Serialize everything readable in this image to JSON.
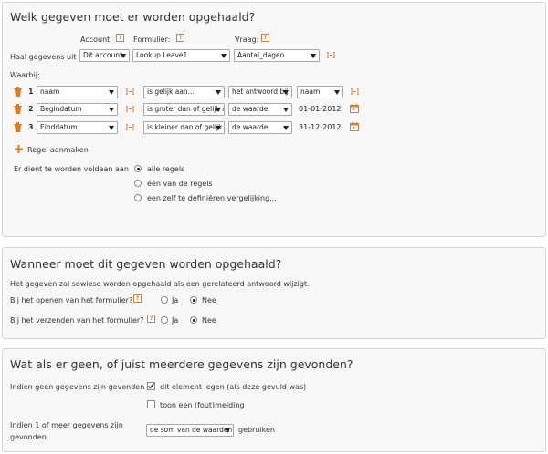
{
  "section1": {
    "title": "Welk gegeven moet er worden opgehaald?",
    "col_account": "Account:",
    "col_formulier": "Formulier:",
    "col_vraag": "Vraag:",
    "haal_label": "Haal gegevens uit",
    "account_value": "Dit account",
    "formulier_value": "Lookup.Leave1",
    "vraag_value": "Aantal_dagen",
    "waarbij": "Waarbij:",
    "rows": [
      {
        "n": "1",
        "field": "naam",
        "operator": "is gelijk aan...",
        "type": "het antwoord bij",
        "value": "naam"
      },
      {
        "n": "2",
        "field": "Begindatum",
        "operator": "is groter dan of gelijk a",
        "type": "de waarde",
        "value": "01-01-2012"
      },
      {
        "n": "3",
        "field": "Einddatum",
        "operator": "is kleiner dan of gelijk a",
        "type": "de waarde",
        "value": "31-12-2012"
      }
    ],
    "add_rule": "Regel aanmaken",
    "condition_label": "Er dient te worden voldaan aan",
    "options": [
      "alle regels",
      "één van de regels",
      "een zelf te definiëren vergelijking..."
    ]
  },
  "section2": {
    "title": "Wanneer moet dit gegeven worden opgehaald?",
    "info": "Het gegeven zal sowieso worden opgehaald als een gerelateerd antwoord wijzigt.",
    "open_label": "Bij het openen van het formulier?",
    "send_label": "Bij het verzenden van het formulier?",
    "ja": "Ja",
    "nee": "Nee"
  },
  "section3": {
    "title": "Wat als er geen, of juist meerdere gegevens zijn gevonden?",
    "none_label": "Indien geen gegevens zijn gevonden",
    "clear_option": "dit element legen (als deze gevuld was)",
    "error_option": "toon een (fout)melding",
    "multi_label_1": "Indien 1 of meer gegevens zijn",
    "multi_label_2": "gevonden",
    "aggregate_value": "de som van de waarden",
    "use_label": "gebruiken"
  },
  "help_glyph": "?",
  "colors": {
    "accent": "#e07b24",
    "panel_bg": "#f8f8f8",
    "panel_border": "#d4d4d4"
  }
}
